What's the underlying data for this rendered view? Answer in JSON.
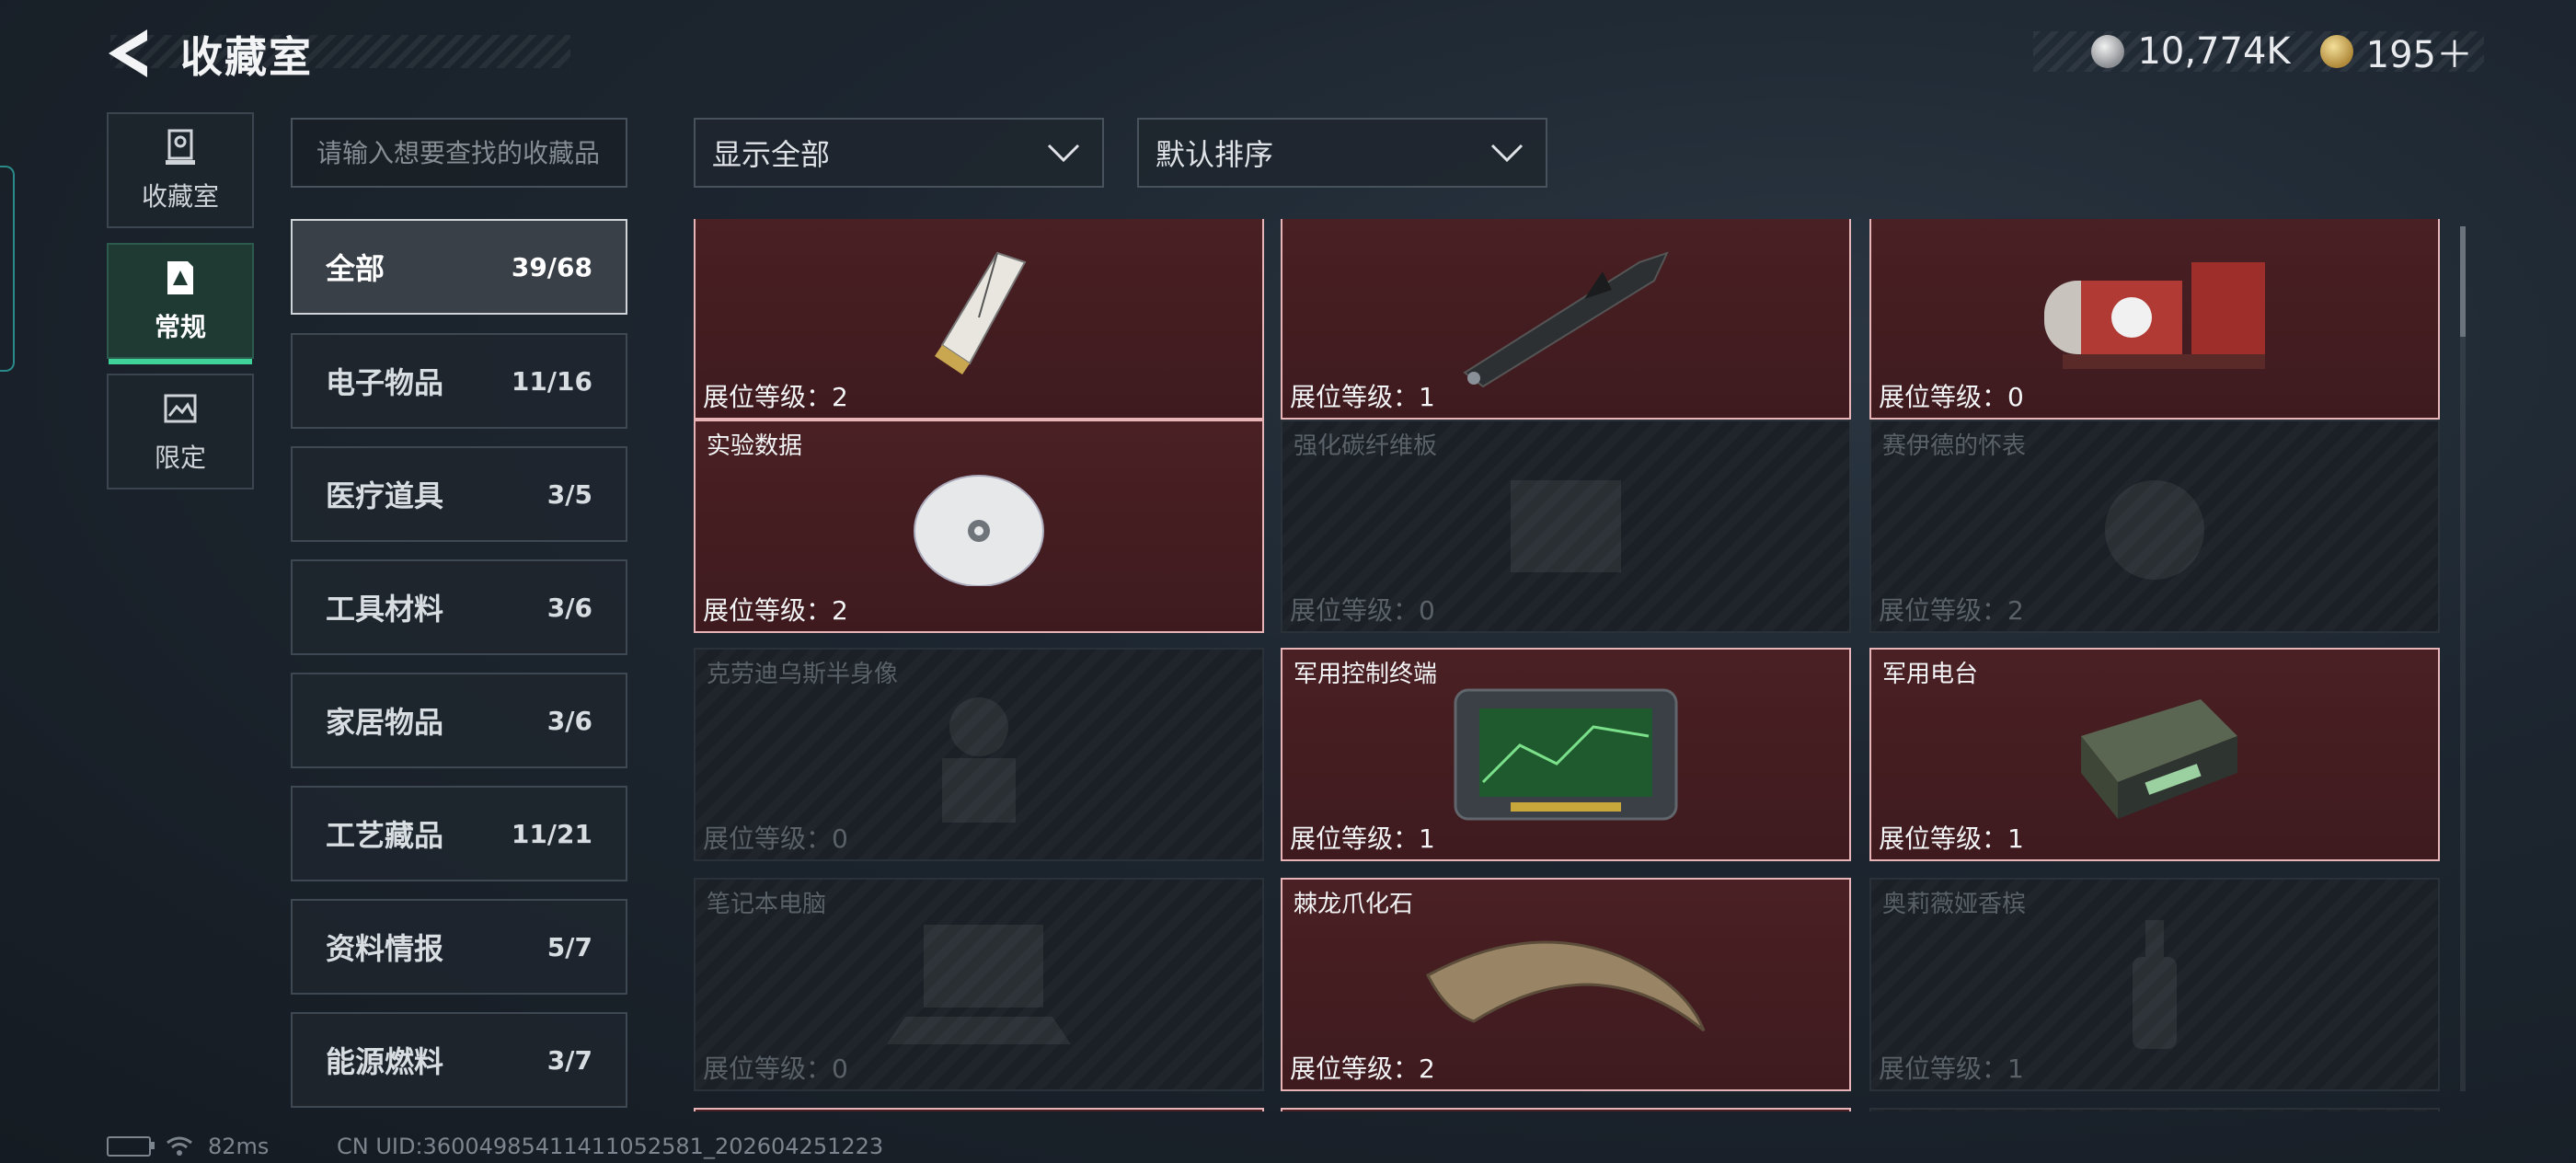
{
  "header": {
    "title": "收藏室",
    "currency_silver": "10,774K",
    "currency_gold": "195＋"
  },
  "side_tabs": [
    {
      "label": "收藏室",
      "icon": "trophy-icon",
      "active": false
    },
    {
      "label": "常规",
      "icon": "collection-card-icon",
      "active": true
    },
    {
      "label": "限定",
      "icon": "limited-image-icon",
      "active": false
    }
  ],
  "search": {
    "placeholder": "请输入想要查找的收藏品"
  },
  "categories": [
    {
      "name": "全部",
      "count": "39/68",
      "active": true
    },
    {
      "name": "电子物品",
      "count": "11/16"
    },
    {
      "name": "医疗道具",
      "count": "3/5"
    },
    {
      "name": "工具材料",
      "count": "3/6"
    },
    {
      "name": "家居物品",
      "count": "3/6"
    },
    {
      "name": "工艺藏品",
      "count": "11/21"
    },
    {
      "name": "资料情报",
      "count": "5/7"
    },
    {
      "name": "能源燃料",
      "count": "3/7"
    }
  ],
  "filters": {
    "display": "显示全部",
    "sort": "默认排序"
  },
  "level_label": "展位等级：",
  "cards": [
    {
      "name": "",
      "level": "2",
      "owned": true,
      "art": "usb-drive"
    },
    {
      "name": "",
      "level": "1",
      "owned": true,
      "art": "missile"
    },
    {
      "name": "",
      "level": "0",
      "owned": true,
      "art": "red-generator"
    },
    {
      "name": "实验数据",
      "level": "2",
      "owned": true,
      "art": "disc"
    },
    {
      "name": "强化碳纤维板",
      "level": "0",
      "owned": false,
      "art": "panel"
    },
    {
      "name": "赛伊德的怀表",
      "level": "2",
      "owned": false,
      "art": "watch"
    },
    {
      "name": "克劳迪乌斯半身像",
      "level": "0",
      "owned": false,
      "art": "bust"
    },
    {
      "name": "军用控制终端",
      "level": "1",
      "owned": true,
      "art": "terminal"
    },
    {
      "name": "军用电台",
      "level": "1",
      "owned": true,
      "art": "radio"
    },
    {
      "name": "笔记本电脑",
      "level": "0",
      "owned": false,
      "art": "laptop"
    },
    {
      "name": "棘龙爪化石",
      "level": "2",
      "owned": true,
      "art": "claw"
    },
    {
      "name": "奥莉薇娅香槟",
      "level": "1",
      "owned": false,
      "art": "bottle"
    }
  ],
  "status": {
    "ping": "82ms",
    "uid": "CN UID:36004985411411052581_202604251223"
  },
  "colors": {
    "owned_card": "#4a2024",
    "active_tab_accent": "#3fd39a",
    "locked_card": "#1f252b"
  }
}
